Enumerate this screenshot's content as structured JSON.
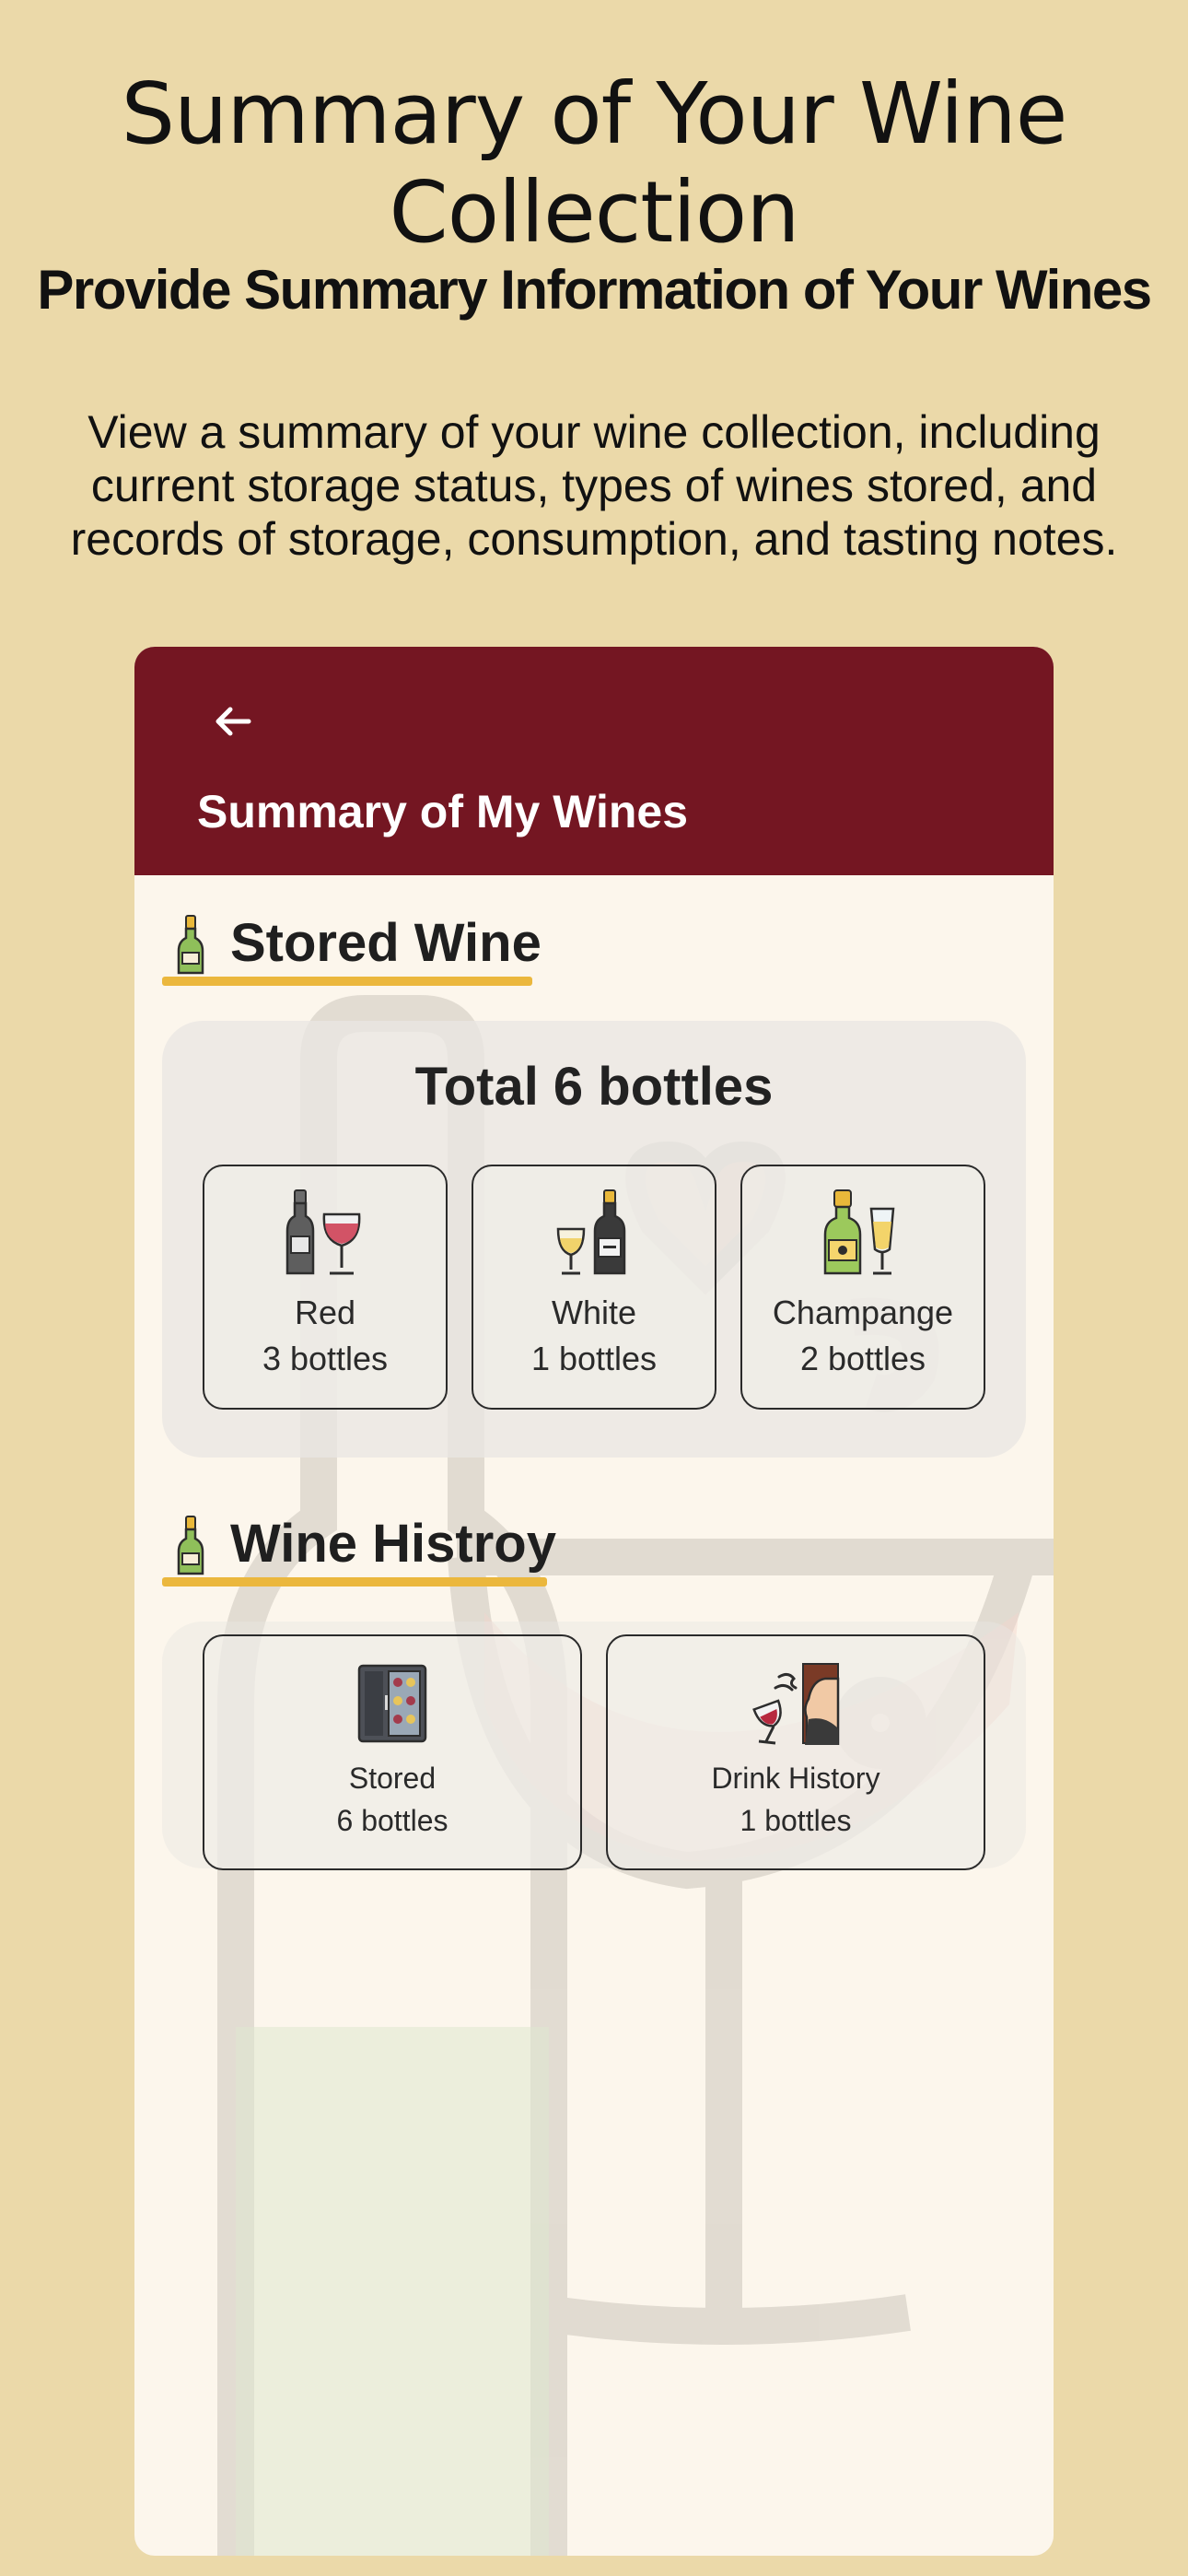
{
  "hero": {
    "title": "Summary of Your Wine Collection",
    "subtitle": "Provide Summary Information of Your Wines",
    "description": "View a summary of your wine collection, including current storage status, types of wines stored, and records of storage, consumption, and tasting notes."
  },
  "appbar": {
    "back_icon": "arrow-left-icon",
    "title": "Summary of My Wines"
  },
  "stored": {
    "heading": "Stored Wine",
    "heading_icon": "wine-bottle-icon",
    "total": "Total 6 bottles",
    "cards": [
      {
        "name": "Red",
        "count": "3 bottles",
        "icon": "red-wine-icon"
      },
      {
        "name": "White",
        "count": "1 bottles",
        "icon": "white-wine-icon"
      },
      {
        "name": "Champange",
        "count": "2 bottles",
        "icon": "champagne-icon"
      }
    ]
  },
  "history": {
    "heading": "Wine Histroy",
    "heading_icon": "wine-bottle-icon",
    "cards": [
      {
        "name": "Stored",
        "count": "6 bottles",
        "icon": "wine-cellar-icon"
      },
      {
        "name": "Drink History",
        "count": "1 bottles",
        "icon": "tasting-person-icon"
      }
    ]
  },
  "colors": {
    "background": "#EBD9A9",
    "appbar": "#741622",
    "accent_underline": "#EBB73D",
    "surface": "#FCF6EC"
  }
}
